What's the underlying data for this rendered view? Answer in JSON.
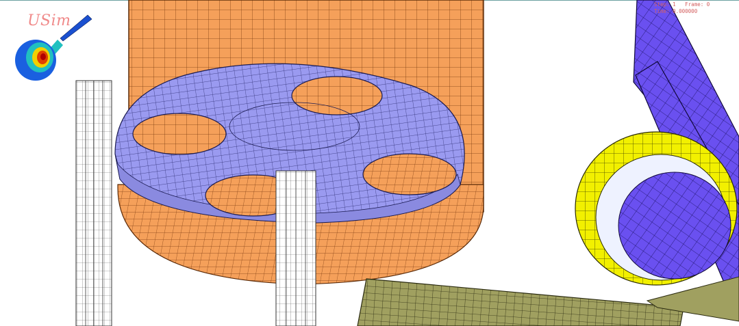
{
  "app": {
    "logo_text": "USim",
    "hud_line1": "Step: 1   Frame: 0",
    "hud_line2": "Time: 0.000000"
  },
  "colors": {
    "background": "#ffffff",
    "orange_part": "#f5a05a",
    "orange_mesh": "#7a3a10",
    "lavender_plate": "#9a9af0",
    "lavender_mesh": "#2a2a70",
    "blue_part": "#6a50f0",
    "yellow_ring": "#f2f000",
    "olive_plate": "#a0a060",
    "white_rail": "#ffffff",
    "logo_text": "#f08a8a",
    "hud_text": "#d46060"
  },
  "icons": {
    "logo": "guitar-fem-contour-icon"
  }
}
